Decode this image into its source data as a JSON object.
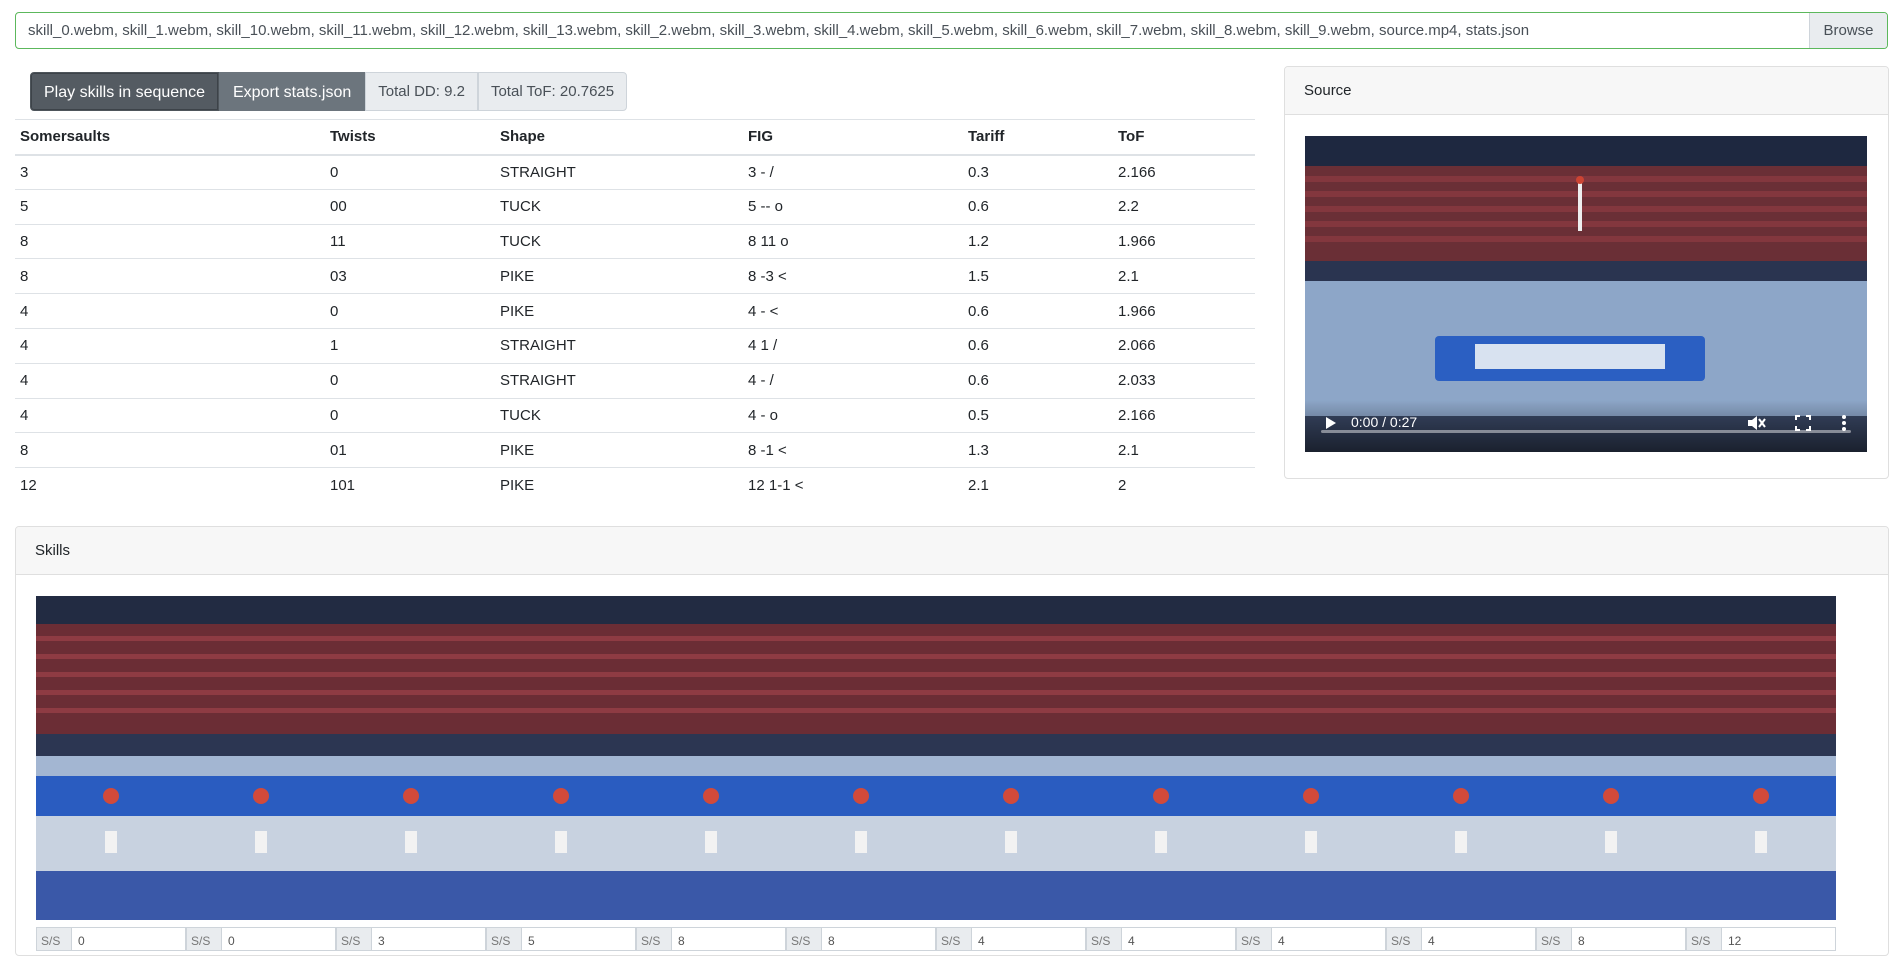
{
  "file_input": {
    "value": "skill_0.webm, skill_1.webm, skill_10.webm, skill_11.webm, skill_12.webm, skill_13.webm, skill_2.webm, skill_3.webm, skill_4.webm, skill_5.webm, skill_6.webm, skill_7.webm, skill_8.webm, skill_9.webm, source.mp4, stats.json",
    "browse_label": "Browse"
  },
  "toolbar": {
    "play_label": "Play skills in sequence",
    "export_label": "Export stats.json",
    "total_dd": "Total DD: 9.2",
    "total_tof": "Total ToF: 20.7625"
  },
  "table": {
    "headers": [
      "Somersaults",
      "Twists",
      "Shape",
      "FIG",
      "Tariff",
      "ToF"
    ],
    "rows": [
      [
        "3",
        "0",
        "STRAIGHT",
        "3 - /",
        "0.3",
        "2.166"
      ],
      [
        "5",
        "00",
        "TUCK",
        "5 -- o",
        "0.6",
        "2.2"
      ],
      [
        "8",
        "11",
        "TUCK",
        "8 11 o",
        "1.2",
        "1.966"
      ],
      [
        "8",
        "03",
        "PIKE",
        "8 -3 <",
        "1.5",
        "2.1"
      ],
      [
        "4",
        "0",
        "PIKE",
        "4 - <",
        "0.6",
        "1.966"
      ],
      [
        "4",
        "1",
        "STRAIGHT",
        "4 1 /",
        "0.6",
        "2.066"
      ],
      [
        "4",
        "0",
        "STRAIGHT",
        "4 - /",
        "0.6",
        "2.033"
      ],
      [
        "4",
        "0",
        "TUCK",
        "4 - o",
        "0.5",
        "2.166"
      ],
      [
        "8",
        "01",
        "PIKE",
        "8 -1 <",
        "1.3",
        "2.1"
      ],
      [
        "12",
        "101",
        "PIKE",
        "12 1-1 <",
        "2.1",
        "2"
      ]
    ]
  },
  "source": {
    "title": "Source",
    "time": "0:00 / 0:27"
  },
  "skills": {
    "title": "Skills",
    "frame_count": 12,
    "mini_values": [
      {
        "prefix": "S/S",
        "value": "0"
      },
      {
        "prefix": "S/S",
        "value": "0"
      },
      {
        "prefix": "S/S",
        "value": "3"
      },
      {
        "prefix": "S/S",
        "value": "5"
      },
      {
        "prefix": "S/S",
        "value": "8"
      },
      {
        "prefix": "S/S",
        "value": "8"
      },
      {
        "prefix": "S/S",
        "value": "4"
      },
      {
        "prefix": "S/S",
        "value": "4"
      },
      {
        "prefix": "S/S",
        "value": "4"
      },
      {
        "prefix": "S/S",
        "value": "4"
      },
      {
        "prefix": "S/S",
        "value": "8"
      },
      {
        "prefix": "S/S",
        "value": "12"
      }
    ]
  }
}
